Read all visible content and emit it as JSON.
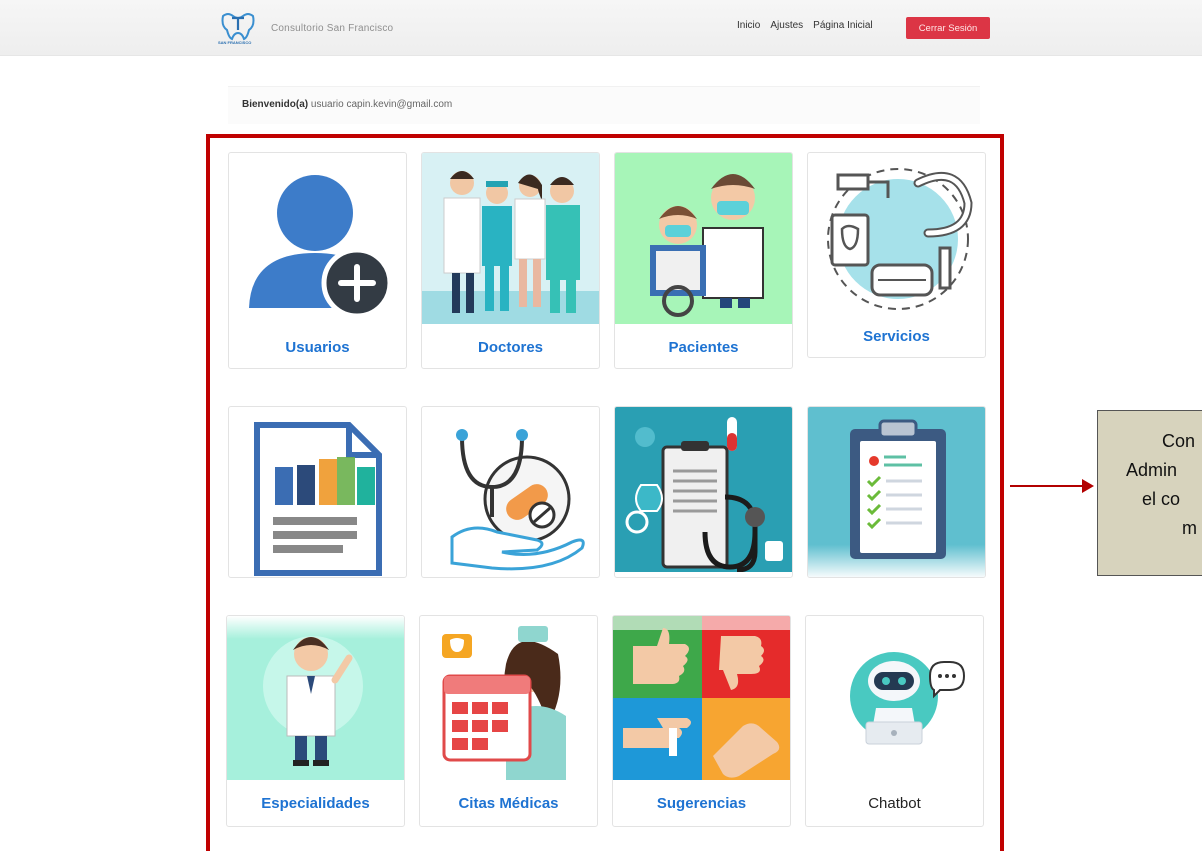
{
  "navbar": {
    "logo_text": "SAN FRANCISCO",
    "brand": "Consultorio San Francisco",
    "links": [
      "Inicio",
      "Ajustes",
      "Página Inicial"
    ],
    "logout": "Cerrar Sesión"
  },
  "welcome": {
    "prefix": "Bienvenido(a)",
    "text": "usuario capin.kevin@gmail.com"
  },
  "cards": {
    "usuarios": "Usuarios",
    "doctores": "Doctores",
    "pacientes": "Pacientes",
    "servicios": "Servicios",
    "especialidades": "Especialidades",
    "citas": "Citas Médicas",
    "sugerencias": "Sugerencias",
    "chatbot": "Chatbot"
  },
  "callout": {
    "lines": [
      "Con",
      "Admin",
      "el co",
      "m"
    ]
  },
  "colors": {
    "accent": "#1e73d2",
    "danger": "#dc3545",
    "frame": "#c00000"
  }
}
